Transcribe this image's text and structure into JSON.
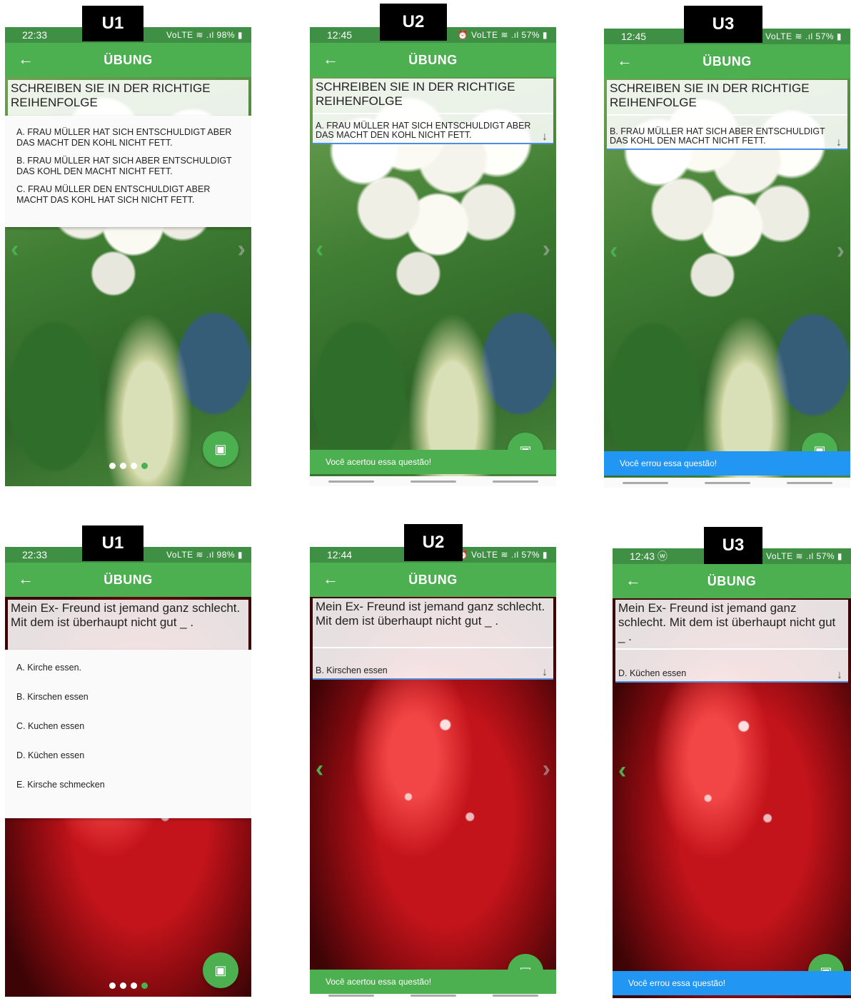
{
  "labels": [
    "U1",
    "U2",
    "U3"
  ],
  "app": {
    "title": "ÜBUNG",
    "back_icon": "arrow-left-icon"
  },
  "row1": {
    "question": "SCHREIBEN SIE IN DER RICHTIGE REIHENFOLGE",
    "options": [
      "A. FRAU MÜLLER HAT SICH ENTSCHULDIGT ABER DAS MACHT DEN KOHL NICHT FETT.",
      "B. FRAU MÜLLER HAT SICH ABER ENTSCHULDIGT DAS KOHL DEN MACHT NICHT FETT.",
      "C. FRAU MÜLLER DEN ENTSCHULDIGT ABER MACHT DAS KOHL HAT SICH NICHT FETT."
    ],
    "u1": {
      "time": "22:33",
      "status_right": "VoLTE ≋ .ıl 98% ▮"
    },
    "u2": {
      "time": "12:45",
      "status_right": "⏰ VoLTE ≋ .ıl 57% ▮",
      "selected": "A. FRAU MÜLLER HAT SICH ENTSCHULDIGT ABER DAS MACHT DEN KOHL NICHT FETT.",
      "snackbar": "Você acertou essa questão!"
    },
    "u3": {
      "time": "12:45",
      "status_right": "⏰ VoLTE ≋ .ıl 57% ▮",
      "selected": "B. FRAU MÜLLER HAT SICH ABER ENTSCHULDIGT DAS KOHL DEN MACHT NICHT FETT.",
      "snackbar": "Você errou essa questão!"
    }
  },
  "row2": {
    "question": "Mein Ex- Freund ist jemand ganz schlecht. Mit dem ist überhaupt nicht gut _ .",
    "options": [
      "A. Kirche essen.",
      "B. Kirschen essen",
      "C. Kuchen essen",
      "D. Küchen essen",
      "E. Kirsche schmecken"
    ],
    "u1": {
      "time": "22:33",
      "status_right": "VoLTE ≋ .ıl 98% ▮"
    },
    "u2": {
      "time": "12:44",
      "status_right": "⏰ VoLTE ≋ .ıl 57% ▮",
      "selected": "B. Kirschen essen",
      "snackbar": "Você acertou essa questão!"
    },
    "u3": {
      "time": "12:43 ⓦ",
      "status_right": "⏰ VoLTE ≋ .ıl 57% ▮",
      "selected": "D. Küchen essen",
      "snackbar": "Você errou essa questão!"
    }
  },
  "colors": {
    "appbar": "#4caf50",
    "success": "#4caf50",
    "error": "#2196f3"
  }
}
